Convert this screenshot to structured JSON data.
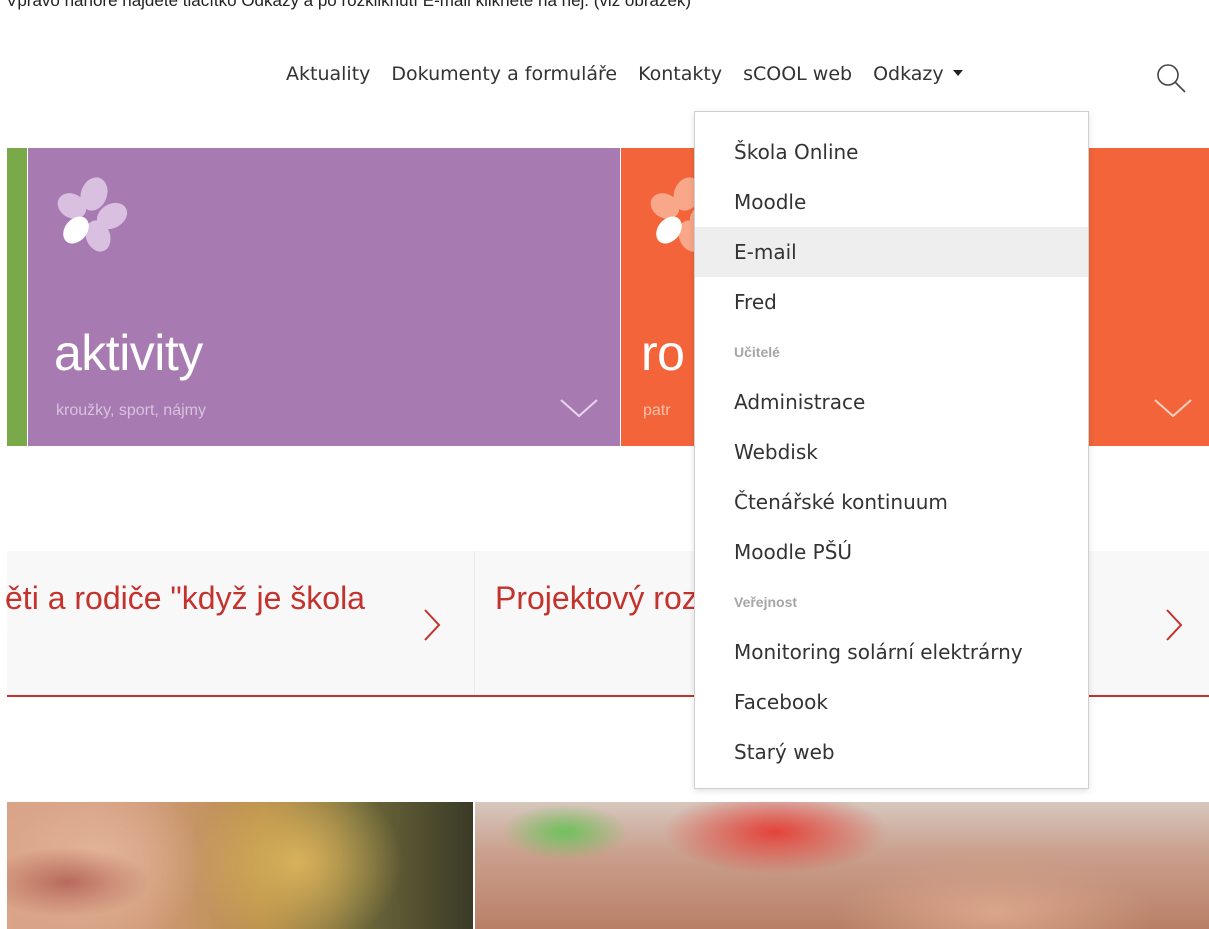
{
  "caption": "Vpravo nahoře najdete tlačítko Odkazy a po rozkliknutí E-mail klikněte na něj. (viz obrázek)",
  "nav": {
    "items": [
      "Aktuality",
      "Dokumenty a formuláře",
      "Kontakty",
      "sCOOL web"
    ],
    "dropdown_label": "Odkazy"
  },
  "tiles": {
    "left": {
      "title": "aktivity",
      "subtitle": "kroužky, sport, nájmy",
      "color": "#a77bb2"
    },
    "right": {
      "title": "ro",
      "subtitle": "patr",
      "color": "#f3643a"
    },
    "accent": "#7aa94a"
  },
  "banner": {
    "left_link": "ěti a rodiče \"když je škola",
    "right_link": "Projektový roz",
    "color": "#c4322e"
  },
  "dropdown": {
    "items": [
      {
        "type": "item",
        "label": "Škola Online"
      },
      {
        "type": "item",
        "label": "Moodle"
      },
      {
        "type": "item",
        "label": "E-mail",
        "active": true
      },
      {
        "type": "item",
        "label": "Fred"
      },
      {
        "type": "header",
        "label": "Učitelé"
      },
      {
        "type": "item",
        "label": "Administrace"
      },
      {
        "type": "item",
        "label": "Webdisk"
      },
      {
        "type": "item",
        "label": "Čtenářské kontinuum"
      },
      {
        "type": "item",
        "label": "Moodle PŠÚ"
      },
      {
        "type": "header",
        "label": "Veřejnost"
      },
      {
        "type": "item",
        "label": "Monitoring solární elektrárny"
      },
      {
        "type": "item",
        "label": "Facebook"
      },
      {
        "type": "item",
        "label": "Starý web"
      }
    ]
  },
  "icons": {
    "search": "search-icon",
    "caret": "caret-down-icon",
    "logo": "flower-logo-icon",
    "chevron": "chevron-down-icon",
    "arrow": "chevron-right-icon"
  }
}
